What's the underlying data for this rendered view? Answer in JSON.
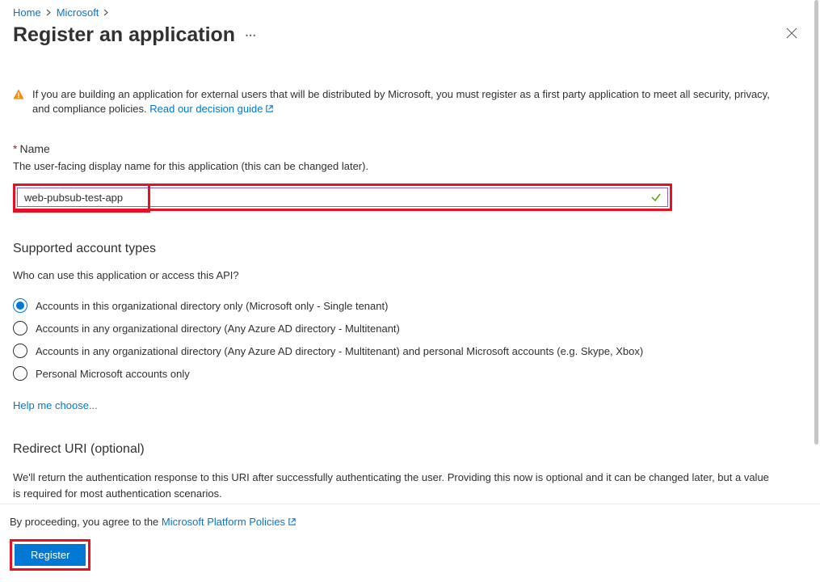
{
  "breadcrumb": {
    "home": "Home",
    "microsoft": "Microsoft"
  },
  "header": {
    "title": "Register an application"
  },
  "warning": {
    "text_before": "If you are building an application for external users that will be distributed by Microsoft, you must register as a first party application to meet all security, privacy, and compliance policies. ",
    "link": "Read our decision guide"
  },
  "name_section": {
    "label": "Name",
    "help": "The user-facing display name for this application (this can be changed later).",
    "value": "web-pubsub-test-app"
  },
  "account_types": {
    "heading": "Supported account types",
    "sub": "Who can use this application or access this API?",
    "options": [
      {
        "label": "Accounts in this organizational directory only (Microsoft only - Single tenant)",
        "checked": true
      },
      {
        "label": "Accounts in any organizational directory (Any Azure AD directory - Multitenant)",
        "checked": false
      },
      {
        "label": "Accounts in any organizational directory (Any Azure AD directory - Multitenant) and personal Microsoft accounts (e.g. Skype, Xbox)",
        "checked": false
      },
      {
        "label": "Personal Microsoft accounts only",
        "checked": false
      }
    ],
    "help_link": "Help me choose..."
  },
  "redirect": {
    "heading": "Redirect URI (optional)",
    "desc": "We'll return the authentication response to this URI after successfully authenticating the user. Providing this now is optional and it can be changed later, but a value is required for most authentication scenarios."
  },
  "footer": {
    "policy_before": "By proceeding, you agree to the ",
    "policy_link": "Microsoft Platform Policies",
    "register": "Register"
  }
}
